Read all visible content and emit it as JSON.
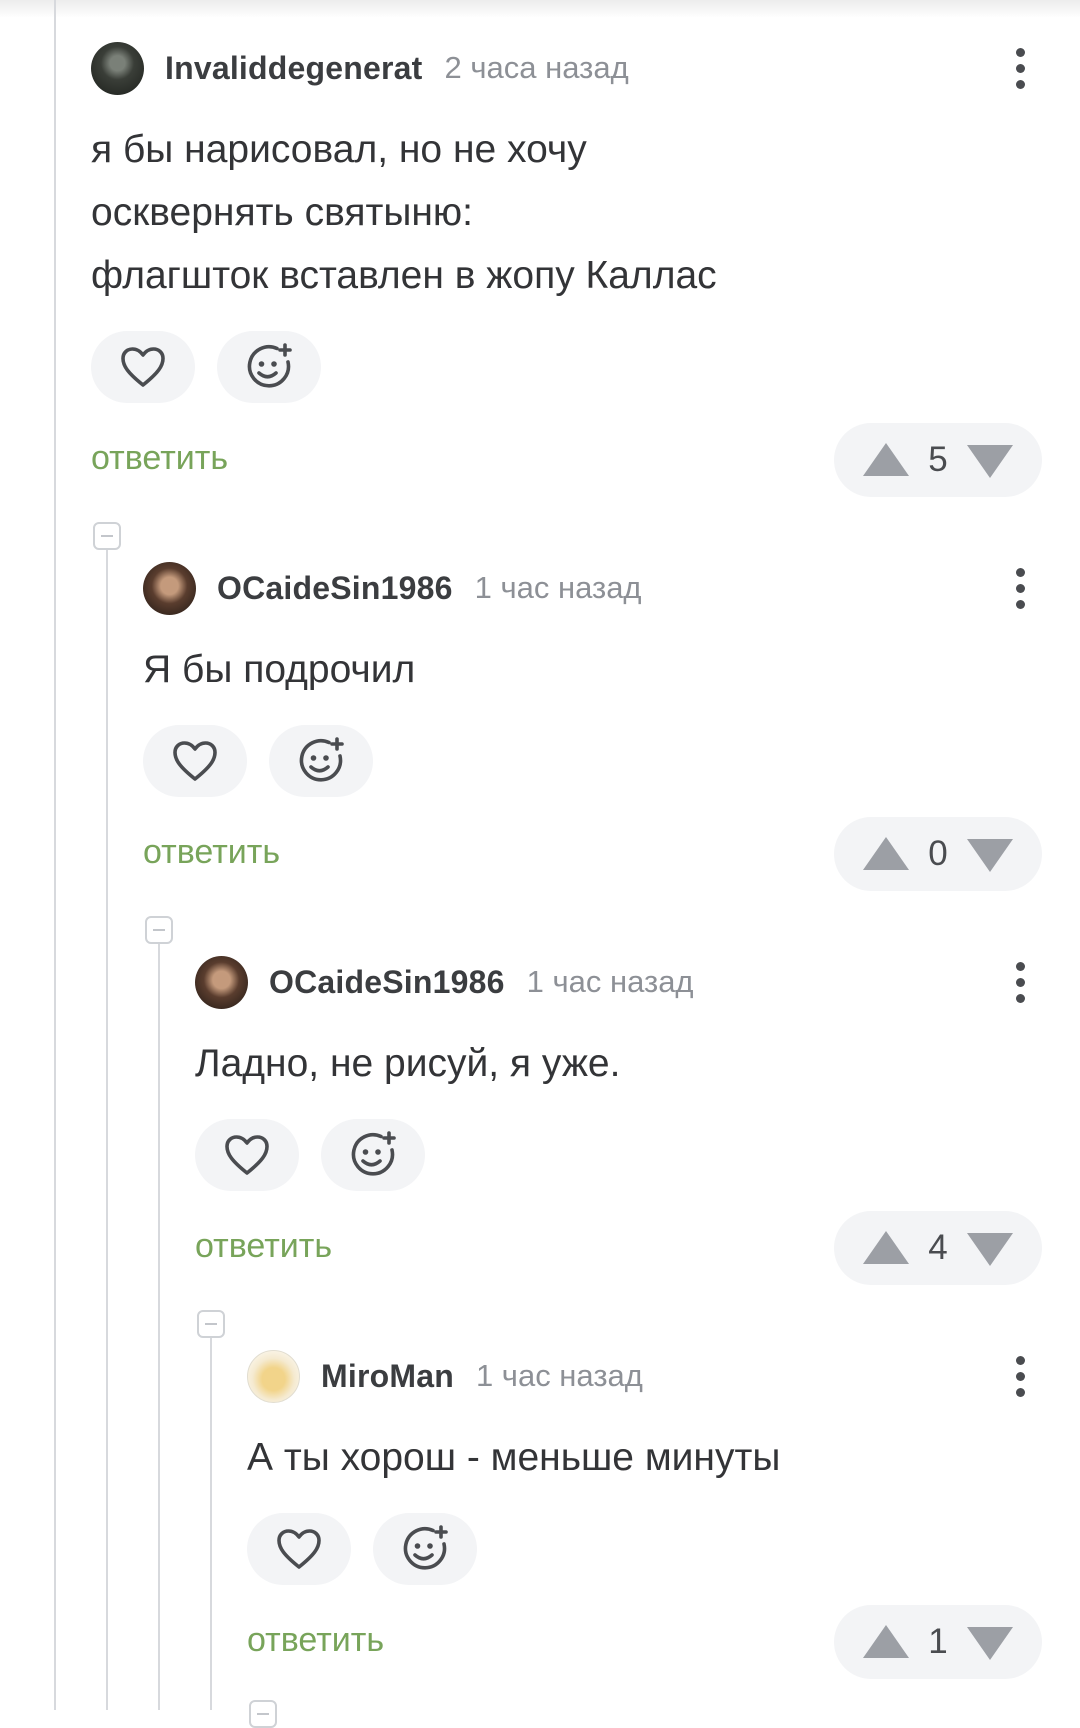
{
  "colors": {
    "reply_link": "#78a45a",
    "username": "#3b3d40",
    "timestamp": "#8d9096",
    "pill_background": "#f3f4f6",
    "vote_arrow": "#9c9fa5",
    "thread_line": "#d7d9dd"
  },
  "icons": {
    "like": "heart-icon",
    "react": "emoji-add-icon",
    "more": "more-vertical-icon",
    "upvote": "triangle-up-icon",
    "downvote": "triangle-down-icon",
    "collapse": "collapse-minus-icon"
  },
  "comments": [
    {
      "username": "Invaliddegenerat",
      "time": "2 часа назад",
      "text": "я бы нарисовал, но не хочу\nосквернять святыню:\nфлагшток вставлен в жопу Каллас",
      "reply_label": "ответить",
      "score": "5"
    },
    {
      "username": "OCaideSin1986",
      "time": "1 час назад",
      "text": "Я бы подрочил",
      "reply_label": "ответить",
      "score": "0"
    },
    {
      "username": "OCaideSin1986",
      "time": "1 час назад",
      "text": "Ладно, не рисуй, я уже.",
      "reply_label": "ответить",
      "score": "4"
    },
    {
      "username": "MiroMan",
      "time": "1 час назад",
      "text": "А ты хорош - меньше минуты",
      "reply_label": "ответить",
      "score": "1"
    }
  ]
}
